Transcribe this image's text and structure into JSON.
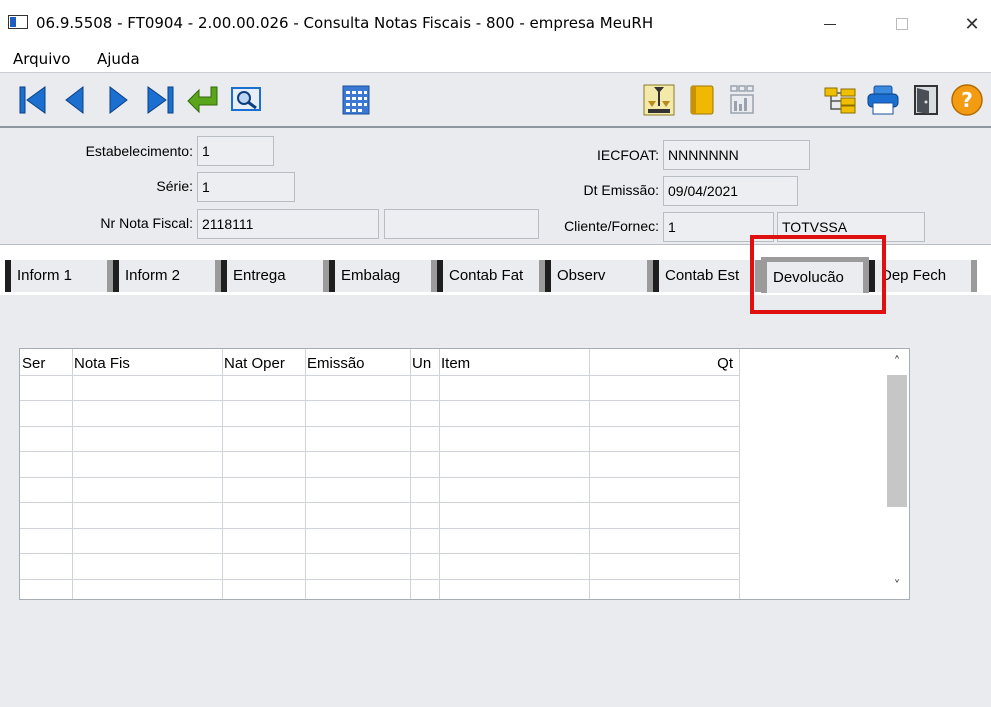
{
  "window": {
    "title": "06.9.5508 - FT0904 - 2.00.00.026 - Consulta Notas Fiscais - 800 - empresa MeuRH",
    "close_glyph": "✕"
  },
  "menu": {
    "items": [
      "Arquivo",
      "Ajuda"
    ]
  },
  "toolbar": {
    "icons": [
      "first-record-icon",
      "previous-record-icon",
      "next-record-icon",
      "last-record-icon",
      "goto-icon",
      "search-icon",
      "calendar-icon",
      "scale-icon",
      "book-icon",
      "report-icon",
      "tree-icon",
      "print-icon",
      "exit-door-icon",
      "help-icon"
    ],
    "help_glyph": "?",
    "colors": {
      "nav_blue": "#1a6fd1",
      "green_arrow": "#5aa51a",
      "yellow": "#f0b800",
      "help_orange": "#f39c12"
    }
  },
  "form": {
    "estabelecimento": {
      "label": "Estabelecimento:",
      "value": "1"
    },
    "serie": {
      "label": "Série:",
      "value": "1"
    },
    "nr_nota_fiscal": {
      "label": "Nr Nota Fiscal:",
      "value": "2118111",
      "extra": ""
    },
    "iecfoat": {
      "label": "IECFOAT:",
      "value": "NNNNNNN"
    },
    "dt_emissao": {
      "label": "Dt Emissão:",
      "value": "09/04/2021"
    },
    "cliente_fornec": {
      "label": "Cliente/Fornec:",
      "value": "1",
      "name": "TOTVSSA"
    }
  },
  "tabs": [
    {
      "label": "Inform 1"
    },
    {
      "label": "Inform 2"
    },
    {
      "label": "Entrega"
    },
    {
      "label": "Embalag"
    },
    {
      "label": "Contab Fat"
    },
    {
      "label": "Observ"
    },
    {
      "label": "Contab Est"
    },
    {
      "label": "Devolucão"
    },
    {
      "label": "Dep Fech"
    }
  ],
  "active_tab": "Devolucão",
  "grid": {
    "columns": [
      "Ser",
      "Nota Fis",
      "Nat Oper",
      "Emissão",
      "Un",
      "Item",
      "Qt"
    ],
    "rows": [],
    "scroll_up": "˄",
    "scroll_down": "˅"
  },
  "highlight_color": "#e01010"
}
